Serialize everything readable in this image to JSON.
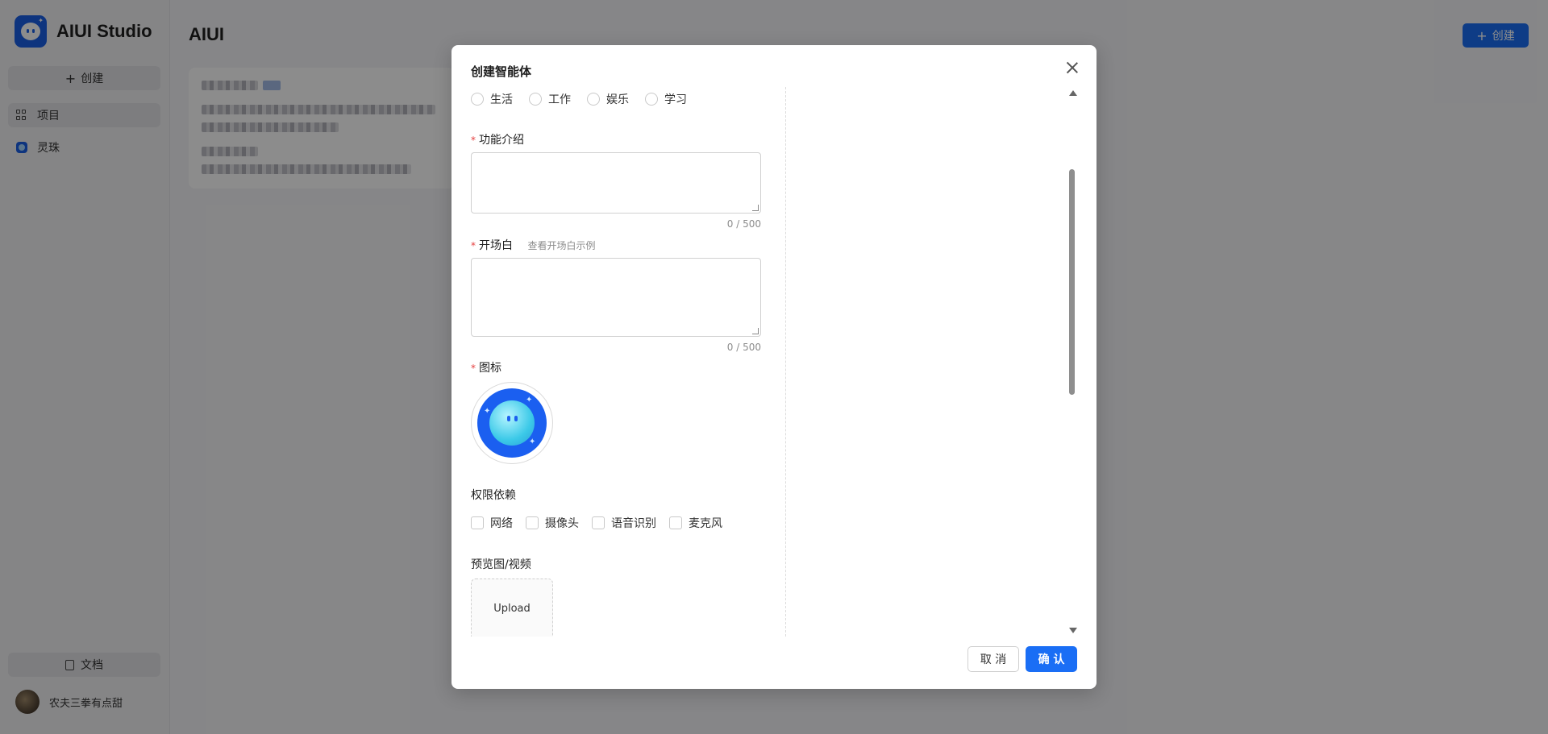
{
  "app": {
    "name": "AIUI Studio"
  },
  "sidebar": {
    "create_label": "创建",
    "items": [
      {
        "label": "项目",
        "icon": "grid-icon"
      },
      {
        "label": "灵珠",
        "icon": "app-icon"
      }
    ],
    "docs_label": "文档",
    "user_name": "农夫三拳有点甜"
  },
  "main": {
    "title": "AIUI",
    "create_label": "创建"
  },
  "modal": {
    "title": "创建智能体",
    "categories": [
      "生活",
      "工作",
      "娱乐",
      "学习"
    ],
    "intro": {
      "label": "功能介绍",
      "value": "",
      "counter": "0 / 500"
    },
    "opening": {
      "label": "开场白",
      "link": "查看开场白示例",
      "value": "",
      "counter": "0 / 500"
    },
    "icon_label": "图标",
    "permissions": {
      "label": "权限依赖",
      "options": [
        "网络",
        "摄像头",
        "语音识别",
        "麦克风"
      ]
    },
    "preview": {
      "label": "预览图/视频",
      "upload_label": "Upload"
    },
    "cancel_label": "取 消",
    "ok_label": "确 认"
  },
  "colors": {
    "primary": "#1a6ef5",
    "brand": "#1a5fe6",
    "required": "#e53e3e"
  }
}
